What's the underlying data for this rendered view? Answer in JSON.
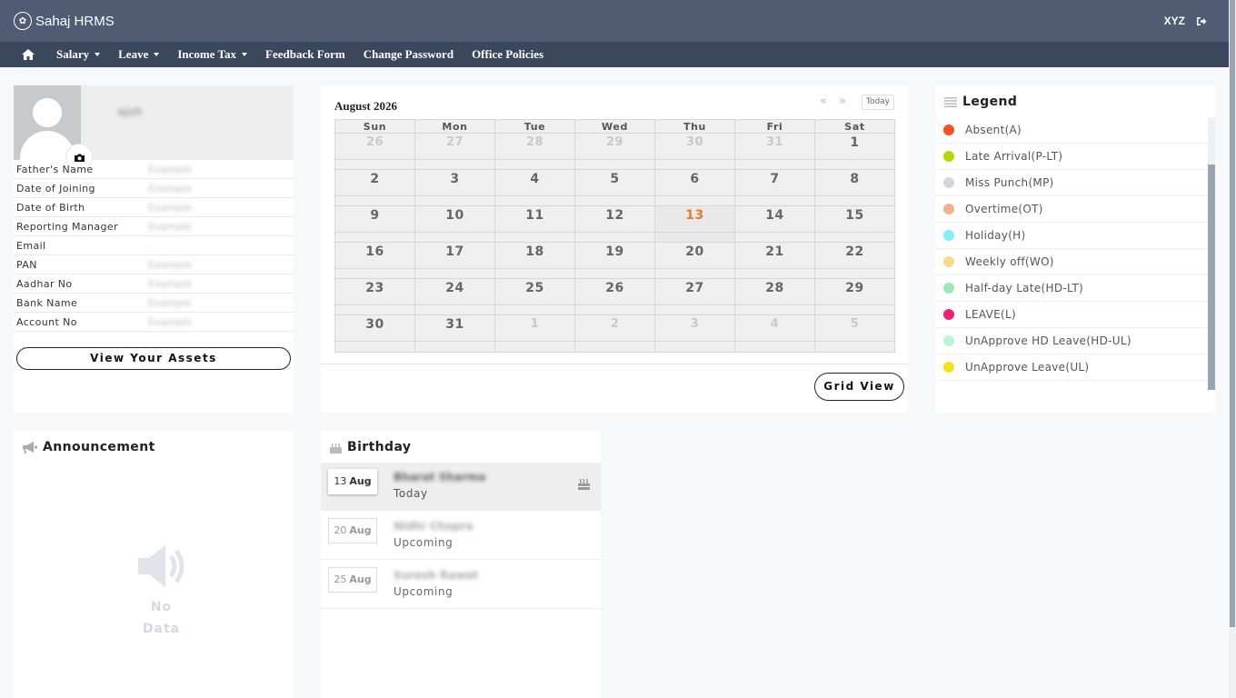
{
  "brand": {
    "name": "Sahaj HRMS"
  },
  "user": {
    "name": "XYZ"
  },
  "nav": [
    {
      "label": "Salary",
      "dropdown": true
    },
    {
      "label": "Leave",
      "dropdown": true
    },
    {
      "label": "Income Tax",
      "dropdown": true
    },
    {
      "label": "Feedback Form",
      "dropdown": false
    },
    {
      "label": "Change Password",
      "dropdown": false
    },
    {
      "label": "Office Policies",
      "dropdown": false
    }
  ],
  "profile": {
    "name": "ajsh",
    "fields": [
      {
        "label": "Father's Name",
        "value": "Example"
      },
      {
        "label": "Date of Joining",
        "value": "Example"
      },
      {
        "label": "Date of Birth",
        "value": "Example"
      },
      {
        "label": "Reporting Manager",
        "value": "Example"
      },
      {
        "label": "Email",
        "value": "-"
      },
      {
        "label": "PAN",
        "value": "Example"
      },
      {
        "label": "Aadhar No",
        "value": "Example"
      },
      {
        "label": "Bank Name",
        "value": "Example"
      },
      {
        "label": "Account No",
        "value": "Example"
      }
    ],
    "assets_button": "View Your Assets"
  },
  "calendar": {
    "title": "August 2026",
    "prev": "«",
    "next": "»",
    "today_label": "Today",
    "weekdays": [
      "Sun",
      "Mon",
      "Tue",
      "Wed",
      "Thu",
      "Fri",
      "Sat"
    ],
    "weeks": [
      [
        {
          "d": "26",
          "out": true
        },
        {
          "d": "27",
          "out": true
        },
        {
          "d": "28",
          "out": true
        },
        {
          "d": "29",
          "out": true
        },
        {
          "d": "30",
          "out": true
        },
        {
          "d": "31",
          "out": true
        },
        {
          "d": "1",
          "out": false
        }
      ],
      [
        {
          "d": "2",
          "out": false
        },
        {
          "d": "3",
          "out": false
        },
        {
          "d": "4",
          "out": false
        },
        {
          "d": "5",
          "out": false
        },
        {
          "d": "6",
          "out": false
        },
        {
          "d": "7",
          "out": false
        },
        {
          "d": "8",
          "out": false
        }
      ],
      [
        {
          "d": "9",
          "out": false
        },
        {
          "d": "10",
          "out": false
        },
        {
          "d": "11",
          "out": false
        },
        {
          "d": "12",
          "out": false
        },
        {
          "d": "13",
          "out": false,
          "today": true
        },
        {
          "d": "14",
          "out": false
        },
        {
          "d": "15",
          "out": false
        }
      ],
      [
        {
          "d": "16",
          "out": false
        },
        {
          "d": "17",
          "out": false
        },
        {
          "d": "18",
          "out": false
        },
        {
          "d": "19",
          "out": false
        },
        {
          "d": "20",
          "out": false
        },
        {
          "d": "21",
          "out": false
        },
        {
          "d": "22",
          "out": false
        }
      ],
      [
        {
          "d": "23",
          "out": false
        },
        {
          "d": "24",
          "out": false
        },
        {
          "d": "25",
          "out": false
        },
        {
          "d": "26",
          "out": false
        },
        {
          "d": "27",
          "out": false
        },
        {
          "d": "28",
          "out": false
        },
        {
          "d": "29",
          "out": false
        }
      ],
      [
        {
          "d": "30",
          "out": false
        },
        {
          "d": "31",
          "out": false
        },
        {
          "d": "1",
          "out": true
        },
        {
          "d": "2",
          "out": true
        },
        {
          "d": "3",
          "out": true
        },
        {
          "d": "4",
          "out": true
        },
        {
          "d": "5",
          "out": true
        }
      ]
    ],
    "grid_button": "Grid View"
  },
  "legend": {
    "title": "Legend",
    "items": [
      {
        "label": "Absent(A)",
        "color": "#f4511e"
      },
      {
        "label": "Late Arrival(P-LT)",
        "color": "#b8d600"
      },
      {
        "label": "Miss Punch(MP)",
        "color": "#d3d6da"
      },
      {
        "label": "Overtime(OT)",
        "color": "#f7b28c"
      },
      {
        "label": "Holiday(H)",
        "color": "#7ef1f7"
      },
      {
        "label": "Weekly off(WO)",
        "color": "#fcd98a"
      },
      {
        "label": "Half-day Late(HD-LT)",
        "color": "#9be8b4"
      },
      {
        "label": "LEAVE(L)",
        "color": "#ef1f78"
      },
      {
        "label": "UnApprove HD Leave(HD-UL)",
        "color": "#b8f5d4"
      },
      {
        "label": "UnApprove Leave(UL)",
        "color": "#f5e11a"
      }
    ]
  },
  "announcement": {
    "title": "Announcement",
    "empty_line1": "No",
    "empty_line2": "Data"
  },
  "birthday": {
    "title": "Birthday",
    "items": [
      {
        "day": "13",
        "month": "Aug",
        "name": "Bharat Sharma",
        "status": "Today",
        "current": true
      },
      {
        "day": "20",
        "month": "Aug",
        "name": "Nidhi Chopra",
        "status": "Upcoming",
        "current": false
      },
      {
        "day": "25",
        "month": "Aug",
        "name": "Suresh Rawat",
        "status": "Upcoming",
        "current": false
      }
    ]
  }
}
